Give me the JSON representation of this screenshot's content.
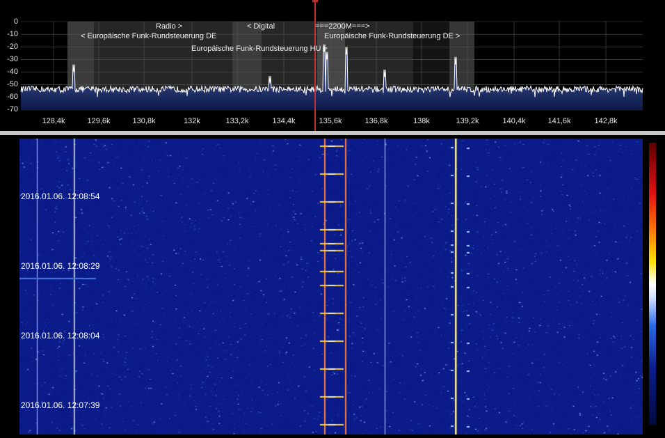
{
  "spectrum": {
    "y_labels": [
      "0",
      "-10",
      "-20",
      "-30",
      "-40",
      "-50",
      "-60",
      "-70"
    ],
    "x_labels": [
      "128,4k",
      "129,6k",
      "130,8k",
      "132k",
      "133,2k",
      "134,4k",
      "135,6k",
      "136,8k",
      "138k",
      "139,2k",
      "140,4k",
      "141,6k",
      "142,8k"
    ],
    "bands": {
      "radio": "Radio >",
      "digital": "< Digital",
      "ham": "===2200M===>",
      "frs_de_left": "< Europäische Funk-Rundsteuerung DE",
      "frs_de_right": "Europäische Funk-Rundsteuerung DE >",
      "frs_hu": "Europäische Funk-Rundsteuerung HU >"
    },
    "colors": {
      "trace": "#ffffff",
      "fill_top": "#3a4f9a",
      "fill_bottom": "#0c1a4a",
      "marker": "#c03030"
    }
  },
  "waterfall": {
    "timestamps": [
      "2016.01.06. 12:08:54",
      "2016.01.06. 12:08:29",
      "2016.01.06. 12:08:04",
      "2016.01.06. 12:07:39"
    ],
    "colors": {
      "background": "#0a1a8c",
      "signal_orange": "#ff7a3a",
      "signal_yellow": "#ffe040"
    }
  },
  "colorbar": {
    "icon": "color-scale-icon"
  }
}
